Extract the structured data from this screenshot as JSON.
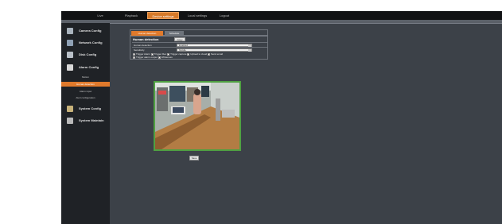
{
  "topnav": [
    {
      "label": "Live"
    },
    {
      "label": "Playback"
    },
    {
      "label": "Device settings"
    },
    {
      "label": "Local settings"
    },
    {
      "label": "Logout"
    }
  ],
  "sidebar": {
    "items": [
      {
        "label": "Camera Config",
        "icon": "camera-icon"
      },
      {
        "label": "Network Config",
        "icon": "network-icon"
      },
      {
        "label": "Disk Config",
        "icon": "disk-icon"
      },
      {
        "label": "Alarm Config",
        "icon": "alarm-icon"
      },
      {
        "label": "System Config",
        "icon": "system-icon"
      },
      {
        "label": "System Maintain",
        "icon": "maintain-icon"
      }
    ],
    "subitems": [
      {
        "label": "Motion"
      },
      {
        "label": "Human detection"
      },
      {
        "label": "Alarm input"
      },
      {
        "label": "Alert configuration"
      }
    ]
  },
  "tabs": [
    {
      "label": "Human detection"
    },
    {
      "label": "Schedule"
    }
  ],
  "panel": {
    "title": "Human detection",
    "copy_label": "Copy",
    "rows": [
      {
        "label": "Human detection",
        "value": "Enabled"
      },
      {
        "label": "Sensitivity",
        "value": "Middle"
      }
    ],
    "checks_line1": [
      "Trigger Alarm",
      "Trigger Rec",
      "Trigger capture",
      "Upload to cloud",
      "Send email"
    ],
    "checks_line2": [
      "Trigger alarm output",
      "Whiteness"
    ]
  },
  "save_label": "Save",
  "colors": {
    "accent": "#e07a2c",
    "frame": "#3c4148",
    "sidebar": "#1f2226",
    "topbar": "#111214",
    "detect_border": "#4fa042"
  }
}
